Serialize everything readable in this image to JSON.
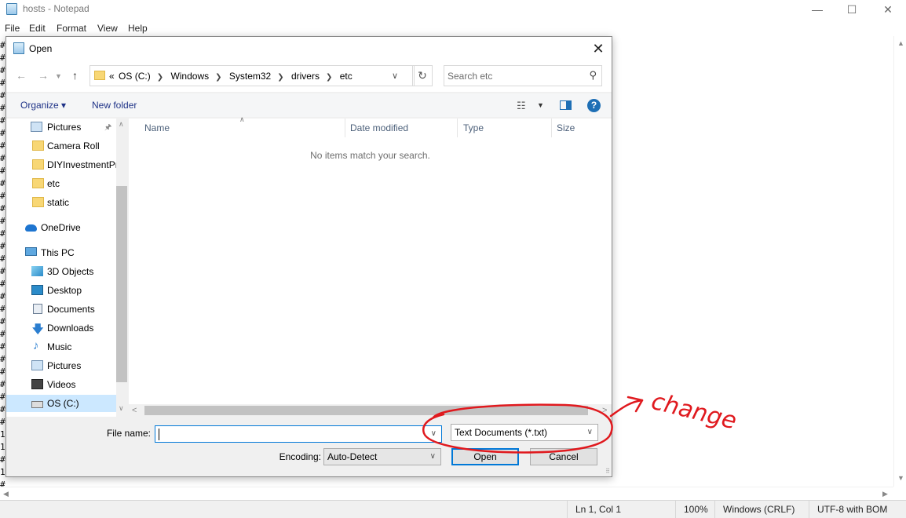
{
  "notepad": {
    "title": "hosts - Notepad",
    "menu": [
      "File",
      "Edit",
      "Format",
      "View",
      "Help"
    ],
    "gutter_chars": "#\n#\n#\n#\n#\n#\n#\n#\n#\n#\n#\n#\n#\n#\n#\n#\n#\n#\n#\n#\n#\n#\n#\n#\n#\n#\n#\n#\n#\n#\n#\n1\n1\n#\n1\n#",
    "status": {
      "position": "Ln 1, Col 1",
      "zoom": "100%",
      "line_ending": "Windows (CRLF)",
      "encoding": "UTF-8 with BOM"
    }
  },
  "dialog": {
    "title": "Open",
    "breadcrumb": [
      "«",
      "OS (C:)",
      "Windows",
      "System32",
      "drivers",
      "etc"
    ],
    "search_placeholder": "Search etc",
    "toolbar": {
      "organize": "Organize ▾",
      "new_folder": "New folder"
    },
    "nav_items": [
      {
        "label": "Pictures",
        "icon": "pictures-icon"
      },
      {
        "label": "Camera Roll",
        "icon": "folder-icon"
      },
      {
        "label": "DIYInvestmentPr",
        "icon": "folder-icon"
      },
      {
        "label": "etc",
        "icon": "folder-icon"
      },
      {
        "label": "static",
        "icon": "folder-icon"
      },
      {
        "label": "OneDrive",
        "icon": "onedrive-icon"
      },
      {
        "label": "This PC",
        "icon": "computer-icon"
      },
      {
        "label": "3D Objects",
        "icon": "3d-objects-icon"
      },
      {
        "label": "Desktop",
        "icon": "desktop-icon"
      },
      {
        "label": "Documents",
        "icon": "documents-icon"
      },
      {
        "label": "Downloads",
        "icon": "downloads-icon"
      },
      {
        "label": "Music",
        "icon": "music-icon"
      },
      {
        "label": "Pictures",
        "icon": "pictures-icon"
      },
      {
        "label": "Videos",
        "icon": "videos-icon"
      },
      {
        "label": "OS (C:)",
        "icon": "drive-icon"
      }
    ],
    "columns": [
      "Name",
      "Date modified",
      "Type",
      "Size"
    ],
    "empty_message": "No items match your search.",
    "file_name_label": "File name:",
    "file_name_value": "",
    "file_type": "Text Documents (*.txt)",
    "encoding_label": "Encoding:",
    "encoding_value": "Auto-Detect",
    "open_button": "Open",
    "cancel_button": "Cancel"
  },
  "annotation": {
    "text": "change",
    "color": "#e0191e"
  }
}
